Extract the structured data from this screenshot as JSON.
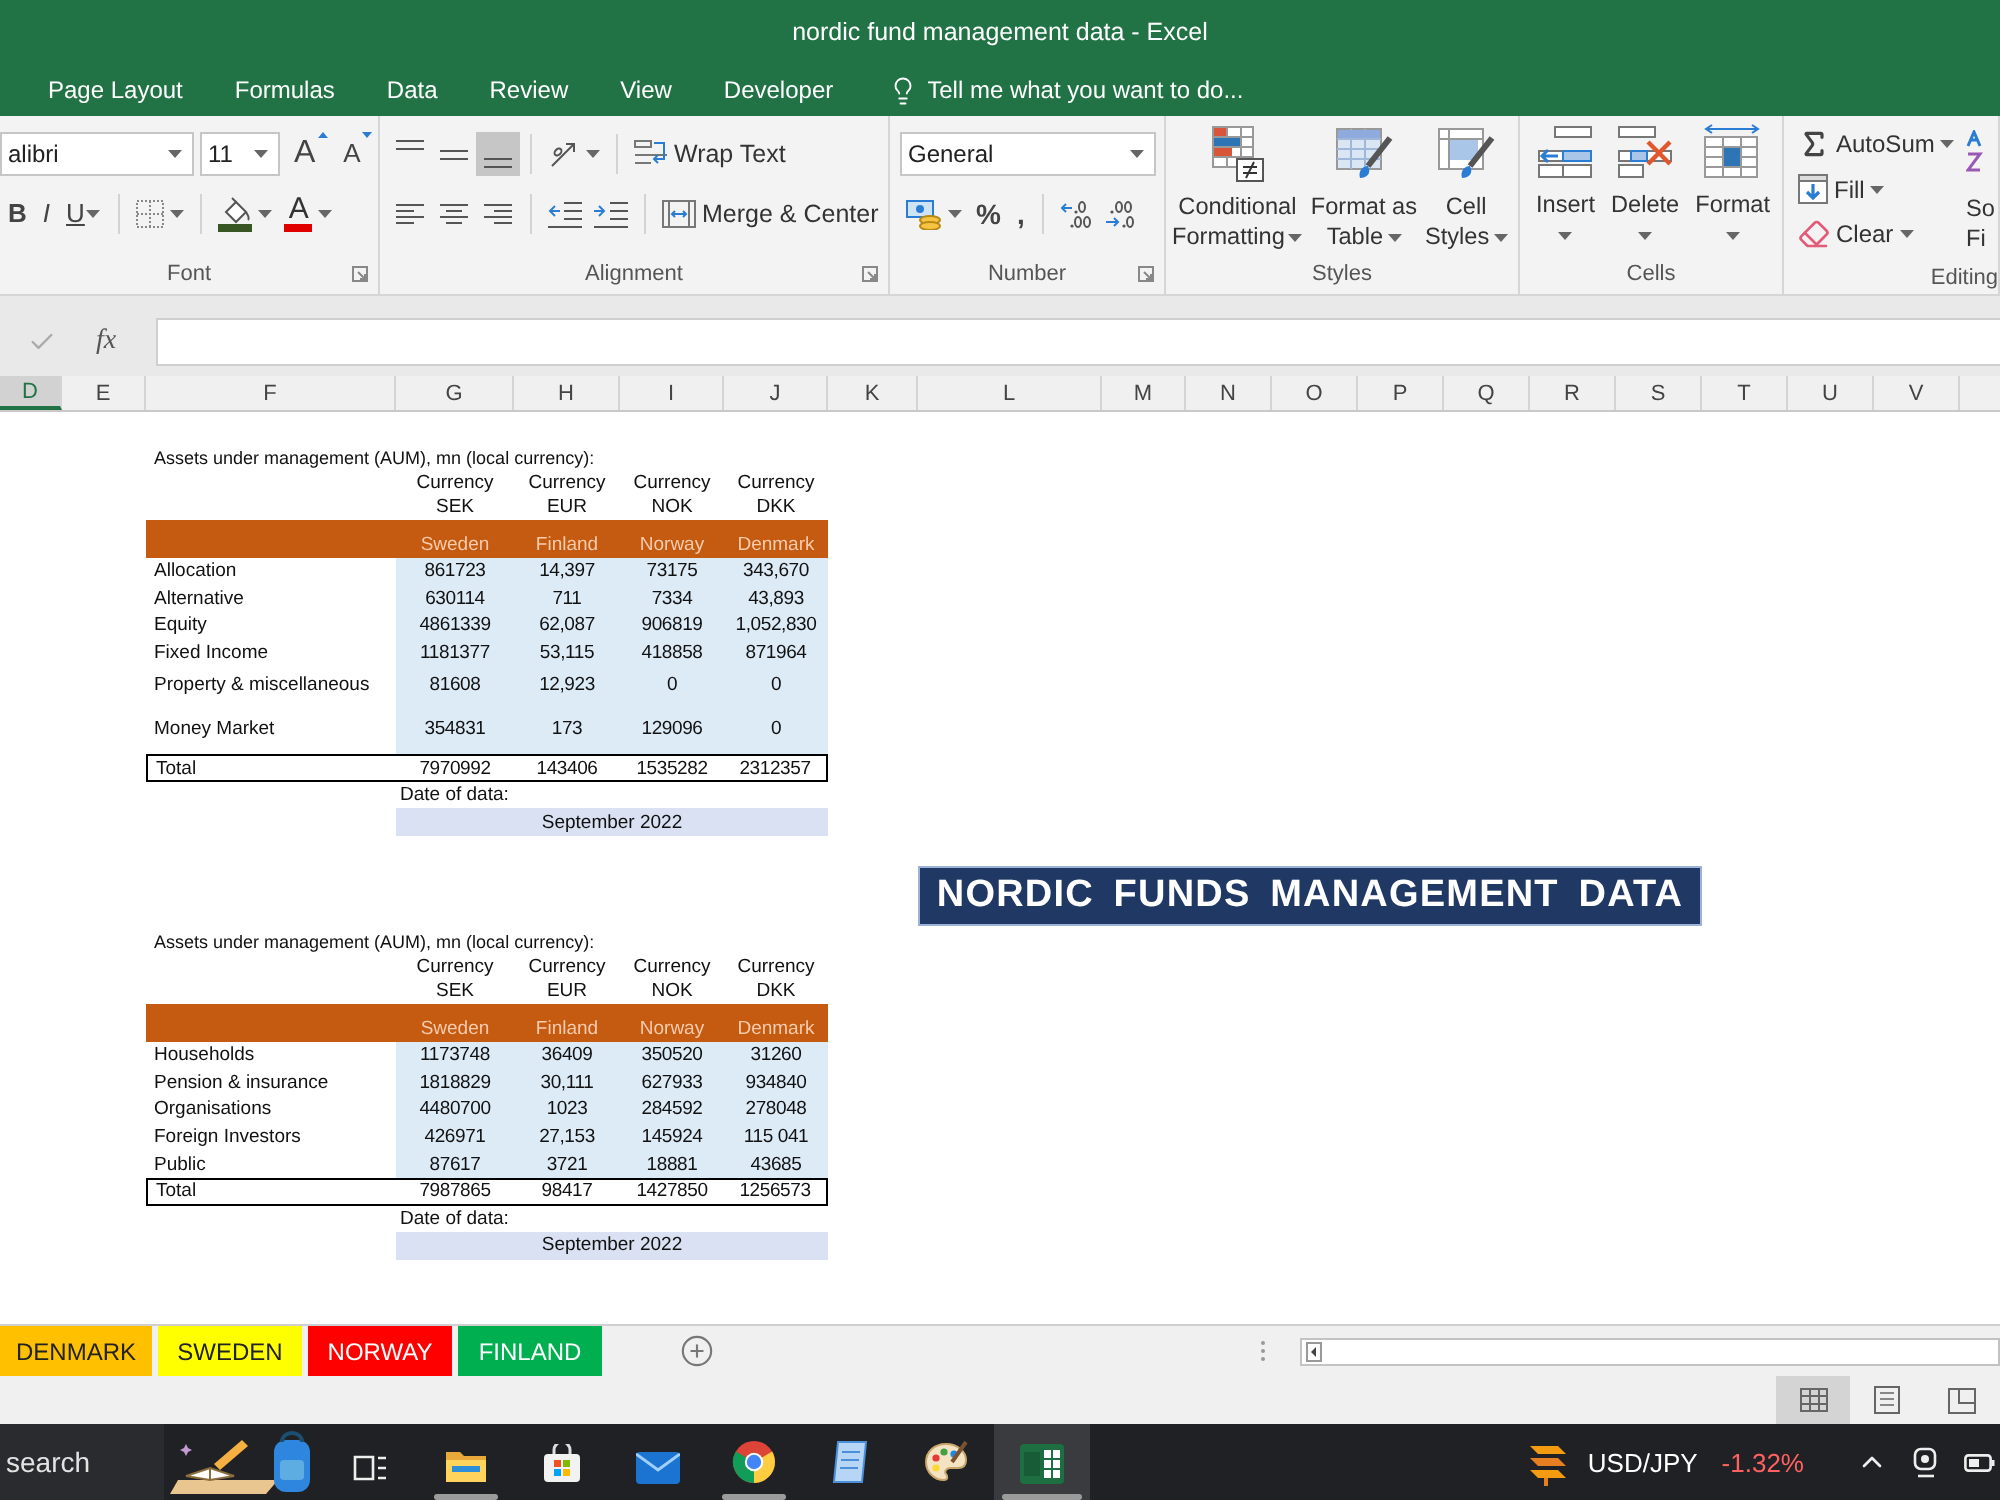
{
  "window": {
    "title": "nordic fund management data - Excel"
  },
  "ribbon_tabs": [
    {
      "label": "Page Layout",
      "selected": false
    },
    {
      "label": "Formulas",
      "selected": false
    },
    {
      "label": "Data",
      "selected": false
    },
    {
      "label": "Review",
      "selected": false
    },
    {
      "label": "View",
      "selected": false
    },
    {
      "label": "Developer",
      "selected": false
    }
  ],
  "tell_me": {
    "placeholder": "Tell me what you want to do..."
  },
  "ribbon_groups": [
    {
      "kind": "font",
      "label": "Font",
      "font_name": "alibri",
      "font_size": "11",
      "grow_glyph": "A",
      "shrink_glyph": "A",
      "styles": [
        {
          "kind": "bold",
          "glyph": "B"
        },
        {
          "kind": "italic",
          "glyph": "I"
        },
        {
          "kind": "underline",
          "glyph": "U"
        }
      ],
      "font_color_glyph": "A"
    },
    {
      "kind": "alignment",
      "label": "Alignment",
      "vertical": [
        {
          "selected": false
        },
        {
          "selected": false
        },
        {
          "selected": true
        }
      ],
      "horizontal": [
        {
          "selected": false
        },
        {
          "selected": false
        },
        {
          "selected": false
        }
      ],
      "wrap_text": "Wrap Text",
      "merge": "Merge & Center"
    },
    {
      "kind": "number",
      "label": "Number",
      "format": "General",
      "percent": "%",
      "comma": ","
    },
    {
      "kind": "styles",
      "label": "Styles",
      "buttons": [
        {
          "kind": "conditional",
          "lines": [
            "Conditional",
            "Formatting"
          ]
        },
        {
          "kind": "table",
          "lines": [
            "Format as",
            "Table"
          ]
        },
        {
          "kind": "cell_styles",
          "lines": [
            "Cell",
            "Styles"
          ]
        }
      ]
    },
    {
      "kind": "cells",
      "label": "Cells",
      "buttons": [
        {
          "kind": "insert",
          "label": "Insert"
        },
        {
          "kind": "delete",
          "label": "Delete"
        },
        {
          "kind": "format",
          "label": "Format"
        }
      ]
    },
    {
      "kind": "editing",
      "label": "Editing",
      "buttons": [
        {
          "kind": "autosum",
          "label": "AutoSum"
        },
        {
          "kind": "fill",
          "label": "Fill"
        },
        {
          "kind": "clear",
          "label": "Clear"
        }
      ],
      "sort_lines": [
        "So",
        "Fi"
      ]
    }
  ],
  "formula_bar": {
    "function_label": "fx"
  },
  "columns": [
    {
      "label": "D",
      "selected": true
    },
    {
      "label": "E",
      "selected": false
    },
    {
      "label": "F",
      "selected": false
    },
    {
      "label": "G",
      "selected": false
    },
    {
      "label": "H",
      "selected": false
    },
    {
      "label": "I",
      "selected": false
    },
    {
      "label": "J",
      "selected": false
    },
    {
      "label": "K",
      "selected": false
    },
    {
      "label": "L",
      "selected": false
    },
    {
      "label": "M",
      "selected": false
    },
    {
      "label": "N",
      "selected": false
    },
    {
      "label": "O",
      "selected": false
    },
    {
      "label": "P",
      "selected": false
    },
    {
      "label": "Q",
      "selected": false
    },
    {
      "label": "R",
      "selected": false
    },
    {
      "label": "S",
      "selected": false
    },
    {
      "label": "T",
      "selected": false
    },
    {
      "label": "U",
      "selected": false
    },
    {
      "label": "V",
      "selected": false
    }
  ],
  "tables": [
    {
      "title": "Assets under management (AUM), mn (local currency):",
      "columns": [
        {
          "currency": "Currency",
          "code": "SEK",
          "country": "Sweden"
        },
        {
          "currency": "Currency",
          "code": "EUR",
          "country": "Finland"
        },
        {
          "currency": "Currency",
          "code": "NOK",
          "country": "Norway"
        },
        {
          "currency": "Currency",
          "code": "DKK",
          "country": "Denmark"
        }
      ],
      "rows": [
        {
          "label": "Allocation",
          "values": [
            "861723",
            "14,397",
            "73175",
            "343,670"
          ]
        },
        {
          "label": "Alternative",
          "values": [
            "630114",
            "711",
            "7334",
            "43,893"
          ]
        },
        {
          "label": "Equity",
          "values": [
            "4861339",
            "62,087",
            "906819",
            "1,052,830"
          ]
        },
        {
          "label": "Fixed Income",
          "values": [
            "1181377",
            "53,115",
            "418858",
            "871964"
          ]
        },
        {
          "label": "Property & miscellaneous",
          "values": [
            "81608",
            "12,923",
            "0",
            "0"
          ]
        },
        {
          "label": "Money Market",
          "values": [
            "354831",
            "173",
            "129096",
            "0"
          ]
        }
      ],
      "total": {
        "label": "Total",
        "values": [
          "7970992",
          "143406",
          "1535282",
          "2312357"
        ]
      },
      "date_label": "Date of data:",
      "date": "September 2022"
    },
    {
      "title": "Assets under management (AUM), mn (local currency):",
      "columns": [
        {
          "currency": "Currency",
          "code": "SEK",
          "country": "Sweden"
        },
        {
          "currency": "Currency",
          "code": "EUR",
          "country": "Finland"
        },
        {
          "currency": "Currency",
          "code": "NOK",
          "country": "Norway"
        },
        {
          "currency": "Currency",
          "code": "DKK",
          "country": "Denmark"
        }
      ],
      "rows": [
        {
          "label": "Households",
          "values": [
            "1173748",
            "36409",
            "350520",
            "31260"
          ]
        },
        {
          "label": "Pension & insurance",
          "values": [
            "1818829",
            "30,111",
            "627933",
            "934840"
          ]
        },
        {
          "label": "Organisations",
          "values": [
            "4480700",
            "1023",
            "284592",
            "278048"
          ]
        },
        {
          "label": "Foreign Investors",
          "values": [
            "426971",
            "27,153",
            "145924",
            "115 041"
          ]
        },
        {
          "label": "Public",
          "values": [
            "87617",
            "3721",
            "18881",
            "43685"
          ]
        }
      ],
      "total": {
        "label": "Total",
        "values": [
          "7987865",
          "98417",
          "1427850",
          "1256573"
        ]
      },
      "date_label": "Date of data:",
      "date": "September 2022"
    }
  ],
  "banner": {
    "text": "NORDIC FUNDS MANAGEMENT DATA"
  },
  "sheet_tabs": [
    {
      "label": "DENMARK",
      "color": "#ffc000",
      "selected": false
    },
    {
      "label": "SWEDEN",
      "color": "#ffff00",
      "selected": false
    },
    {
      "label": "NORWAY",
      "color": "#ff0000",
      "selected": false
    },
    {
      "label": "FINLAND",
      "color": "#00b050",
      "selected": false
    }
  ],
  "view_buttons": [
    {
      "selected": true
    },
    {
      "selected": false
    },
    {
      "selected": false
    }
  ],
  "taskbar": {
    "search": {
      "placeholder": "search"
    },
    "apps": [
      {
        "kind": "task_view",
        "running": false,
        "selected": false
      },
      {
        "kind": "explorer",
        "running": true,
        "selected": false
      },
      {
        "kind": "store",
        "running": false,
        "selected": false
      },
      {
        "kind": "mail",
        "running": false,
        "selected": false
      },
      {
        "kind": "chrome",
        "running": true,
        "selected": false
      },
      {
        "kind": "notepad",
        "running": false,
        "selected": false
      },
      {
        "kind": "paint",
        "running": false,
        "selected": false
      },
      {
        "kind": "excel",
        "running": true,
        "selected": true
      }
    ],
    "ticker": {
      "symbol": "USD/JPY",
      "change": "-1.32%"
    }
  }
}
